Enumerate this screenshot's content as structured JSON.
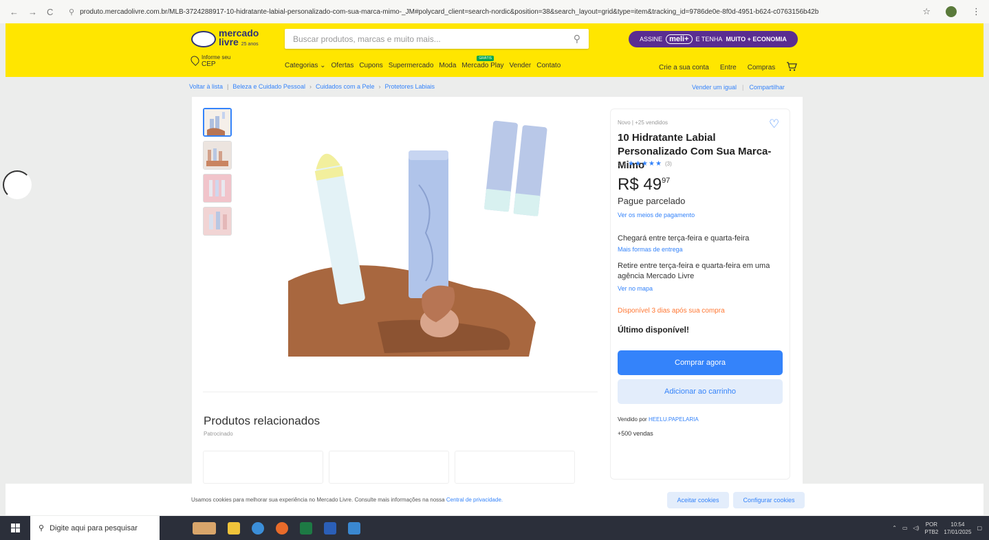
{
  "browser": {
    "url": "produto.mercadolivre.com.br/MLB-3724288917-10-hidratante-labial-personalizado-com-sua-marca-mimo-_JM#polycard_client=search-nordic&position=38&search_layout=grid&type=item&tracking_id=9786de0e-8f0d-4951-b624-c0763156b42b",
    "back_icon": "←",
    "forward_icon": "→",
    "reload_icon": "C",
    "star_icon": "☆",
    "menu_icon": "⋮"
  },
  "header": {
    "logo_text": "mercado livre",
    "logo_line1": "mercado",
    "logo_line2": "livre",
    "logo_small": "25 anos",
    "search_placeholder": "Buscar produtos, marcas e muito mais...",
    "meli_prefix": "ASSINE",
    "meli_label": "meli+",
    "meli_text1": "E TENHA",
    "meli_text2": "MUITO + ECONOMIA",
    "cep_line1": "Informe seu",
    "cep_line2": "CEP",
    "nav": [
      "Categorias ⌄",
      "Ofertas",
      "Cupons",
      "Supermercado",
      "Moda",
      "Mercado Play",
      "Vender",
      "Contato"
    ],
    "play_badge": "GRÁTIS",
    "user_nav": [
      "Crie a sua conta",
      "Entre",
      "Compras"
    ],
    "cart_icon": "🛒"
  },
  "breadcrumb": {
    "items": [
      "Voltar à lista",
      "|",
      "Beleza e Cuidado Pessoal",
      "›",
      "Cuidados com a Pele",
      "›",
      "Protetores Labiais"
    ],
    "right": [
      "Vender um igual",
      "|",
      "Compartilhar"
    ]
  },
  "product": {
    "meta": "Novo  |  +25 vendidos",
    "title": "10 Hidratante Labial Personalizado Com Sua Marca- Mimo",
    "rating_value": "5.0",
    "stars": "★★★★★",
    "rating_count": "(3)",
    "price_currency": "R$",
    "price_int": "49",
    "price_cents": "97",
    "installments": "Pague parcelado",
    "payment_link": "Ver os meios de pagamento",
    "delivery": "Chegará entre terça-feira e quarta-feira",
    "delivery_link": "Mais formas de entrega",
    "pickup": "Retire entre terça-feira e quarta-feira em uma agência Mercado Livre",
    "map_link": "Ver no mapa",
    "availability": "Disponível 3 dias após sua compra",
    "last": "Último disponível!",
    "buy_now": "Comprar agora",
    "add_cart": "Adicionar ao carrinho",
    "seller_prefix": "Vendido por",
    "seller_name": "HEELU.PAPELARIA",
    "sales": "+500 vendas",
    "heart_icon": "♡"
  },
  "related": {
    "title": "Produtos relacionados",
    "sponsored": "Patrocinado"
  },
  "cookies": {
    "text": "Usamos cookies para melhorar sua experiência no Mercado Livre. Consulte mais informações na nossa",
    "link": "Central de privacidade.",
    "accept": "Aceitar cookies",
    "configure": "Configurar cookies"
  },
  "taskbar": {
    "search_placeholder": "Digite aqui para pesquisar",
    "lang1": "POR",
    "lang2": "PTB2",
    "time": "10:54",
    "date": "17/01/2025"
  },
  "colors": {
    "ml_yellow": "#ffe600",
    "ml_blue": "#3483fa",
    "meli_purple": "#5a2d91",
    "availability_orange": "#ff7733"
  }
}
